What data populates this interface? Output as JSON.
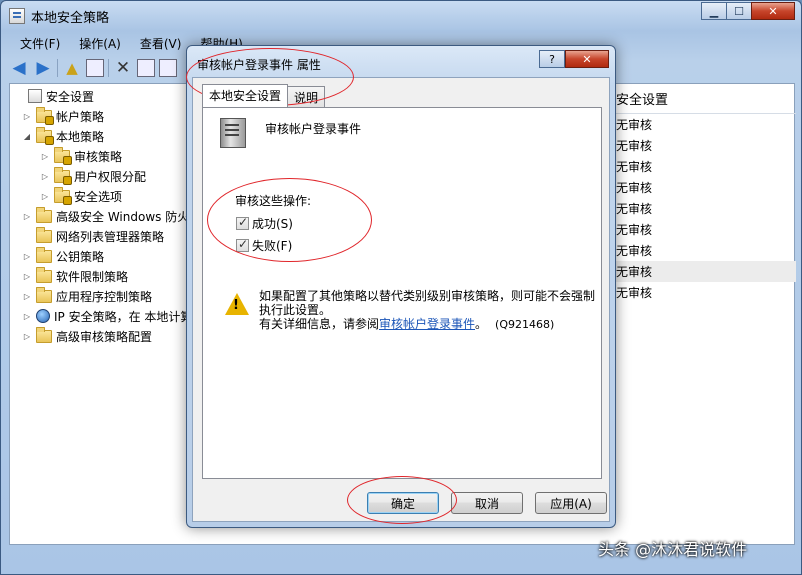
{
  "window": {
    "title": "本地安全策略",
    "min": "▁",
    "max": "☐",
    "close": "✕"
  },
  "menu": [
    "文件(F)",
    "操作(A)",
    "查看(V)",
    "帮助(H)"
  ],
  "tree": [
    {
      "label": "安全设置",
      "exp": "",
      "icon": "root"
    },
    {
      "label": "帐户策略",
      "exp": "▷",
      "icon": "folder-lock"
    },
    {
      "label": "本地策略",
      "exp": "◢",
      "icon": "folder-lock"
    },
    {
      "label": "审核策略",
      "exp": "▷",
      "icon": "folder-lock"
    },
    {
      "label": "用户权限分配",
      "exp": "▷",
      "icon": "folder-lock"
    },
    {
      "label": "安全选项",
      "exp": "▷",
      "icon": "folder-lock"
    },
    {
      "label": "高级安全 Windows 防火",
      "exp": "▷",
      "icon": "folder"
    },
    {
      "label": "网络列表管理器策略",
      "exp": "",
      "icon": "folder"
    },
    {
      "label": "公钥策略",
      "exp": "▷",
      "icon": "folder"
    },
    {
      "label": "软件限制策略",
      "exp": "▷",
      "icon": "folder"
    },
    {
      "label": "应用程序控制策略",
      "exp": "▷",
      "icon": "folder"
    },
    {
      "label": "IP 安全策略，在 本地计算",
      "exp": "▷",
      "icon": "ip"
    },
    {
      "label": "高级审核策略配置",
      "exp": "▷",
      "icon": "folder"
    }
  ],
  "list": {
    "header": "安全设置",
    "cells": [
      "无审核",
      "无审核",
      "无审核",
      "无审核",
      "无审核",
      "无审核",
      "无审核",
      "无审核",
      "无审核"
    ],
    "selected_index": 7
  },
  "dialog": {
    "title": "审核帐户登录事件 属性",
    "help": "?",
    "close": "✕",
    "tabs": [
      "本地安全设置",
      "说明"
    ],
    "policy_name": "审核帐户登录事件",
    "group_label": "审核这些操作:",
    "checkboxes": [
      {
        "label": "成功(S)",
        "checked": true
      },
      {
        "label": "失败(F)",
        "checked": true
      }
    ],
    "warning_line1": "如果配置了其他策略以替代类别级别审核策略，则可能不会强制执行此设置。",
    "warning_line2_prefix": "有关详细信息，请参阅",
    "warning_link": "审核帐户登录事件",
    "warning_line2_suffix": "。",
    "kb": "(Q921468)",
    "buttons": {
      "ok": "确定",
      "cancel": "取消",
      "apply": "应用(A)"
    }
  },
  "watermark": "头条 @沐沐君说软件",
  "colors": {
    "annotation": "#e0262b",
    "link": "#1c56b8"
  }
}
